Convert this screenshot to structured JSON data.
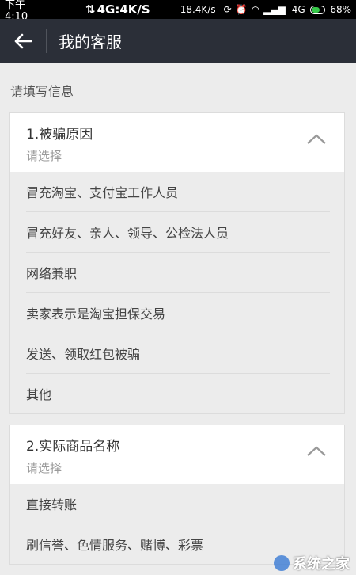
{
  "statusbar": {
    "time": "下午4:10",
    "network": "4G:4K/S",
    "speed": "18.4K/s",
    "signal": "4G",
    "battery": "68%",
    "battery_level": 0.68,
    "battery_color": "#37c94a"
  },
  "appbar": {
    "title": "我的客服",
    "back_icon": "arrow-left-icon"
  },
  "form": {
    "section_label": "请填写信息",
    "cards": [
      {
        "question": "1.被骗原因",
        "hint": "请选择",
        "options": [
          "冒充淘宝、支付宝工作人员",
          "冒充好友、亲人、领导、公检法人员",
          "网络兼职",
          "卖家表示是淘宝担保交易",
          "发送、领取红包被骗",
          "其他"
        ]
      },
      {
        "question": "2.实际商品名称",
        "hint": "请选择",
        "options": [
          "直接转账",
          "刷信誉、色情服务、赌博、彩票"
        ]
      }
    ]
  },
  "watermark": {
    "text": "系统之家"
  }
}
